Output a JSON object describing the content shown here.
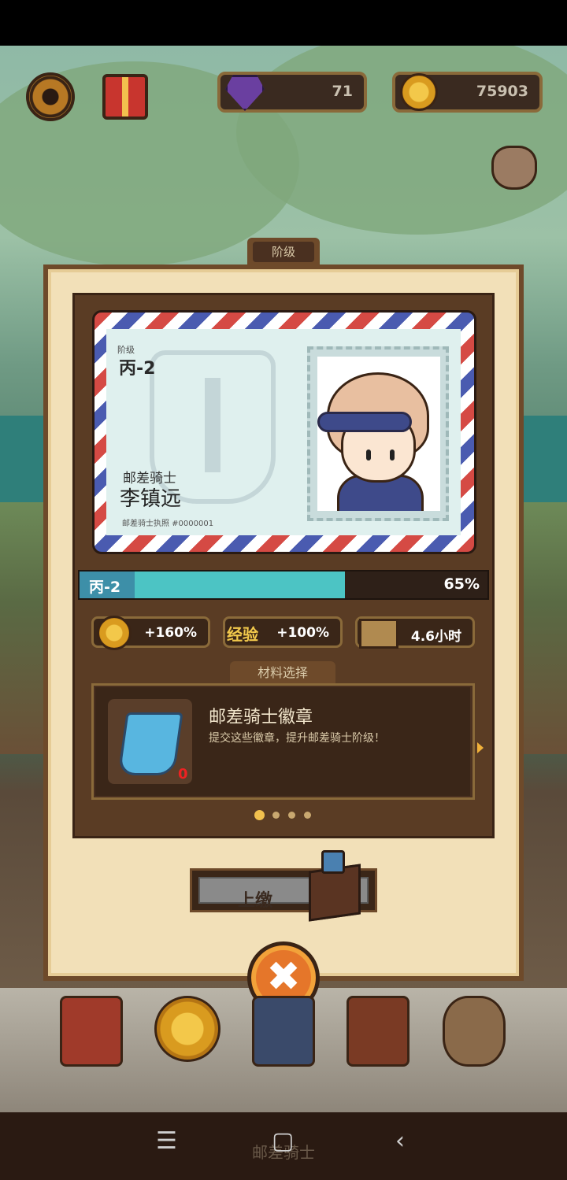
{
  "resources": {
    "gems": "71",
    "coins": "75903"
  },
  "panel": {
    "tab_label": "阶级"
  },
  "license_card": {
    "rank_caption": "阶级",
    "rank": "丙-2",
    "title": "邮差骑士",
    "name": "李镇远",
    "license": "邮差骑士执照 #0000001"
  },
  "progress": {
    "rank": "丙-2",
    "percent_text": "65%",
    "fraction": 0.65
  },
  "bonuses": {
    "coin": "+160%",
    "exp_label": "经验",
    "exp": "+100%",
    "time": "4.6小时"
  },
  "materials": {
    "tab_label": "材料选择",
    "item_name": "邮差骑士徽章",
    "item_desc": "提交这些徽章，提升邮差骑士阶级！",
    "item_count": "0",
    "pages": 4,
    "active_page": 0
  },
  "submit": {
    "label": "上缴"
  },
  "close": {
    "label": "✖"
  },
  "system_nav": {
    "menu": "☰",
    "home": "▢",
    "back": "‹",
    "behind_text": "邮差骑士"
  },
  "colors": {
    "panel_bg": "#f2e0b8",
    "frame_brown": "#6e4a2a",
    "progress_fill": "#4cc4c4",
    "accent_gold": "#f2c14e",
    "close_orange": "#e5762a"
  }
}
